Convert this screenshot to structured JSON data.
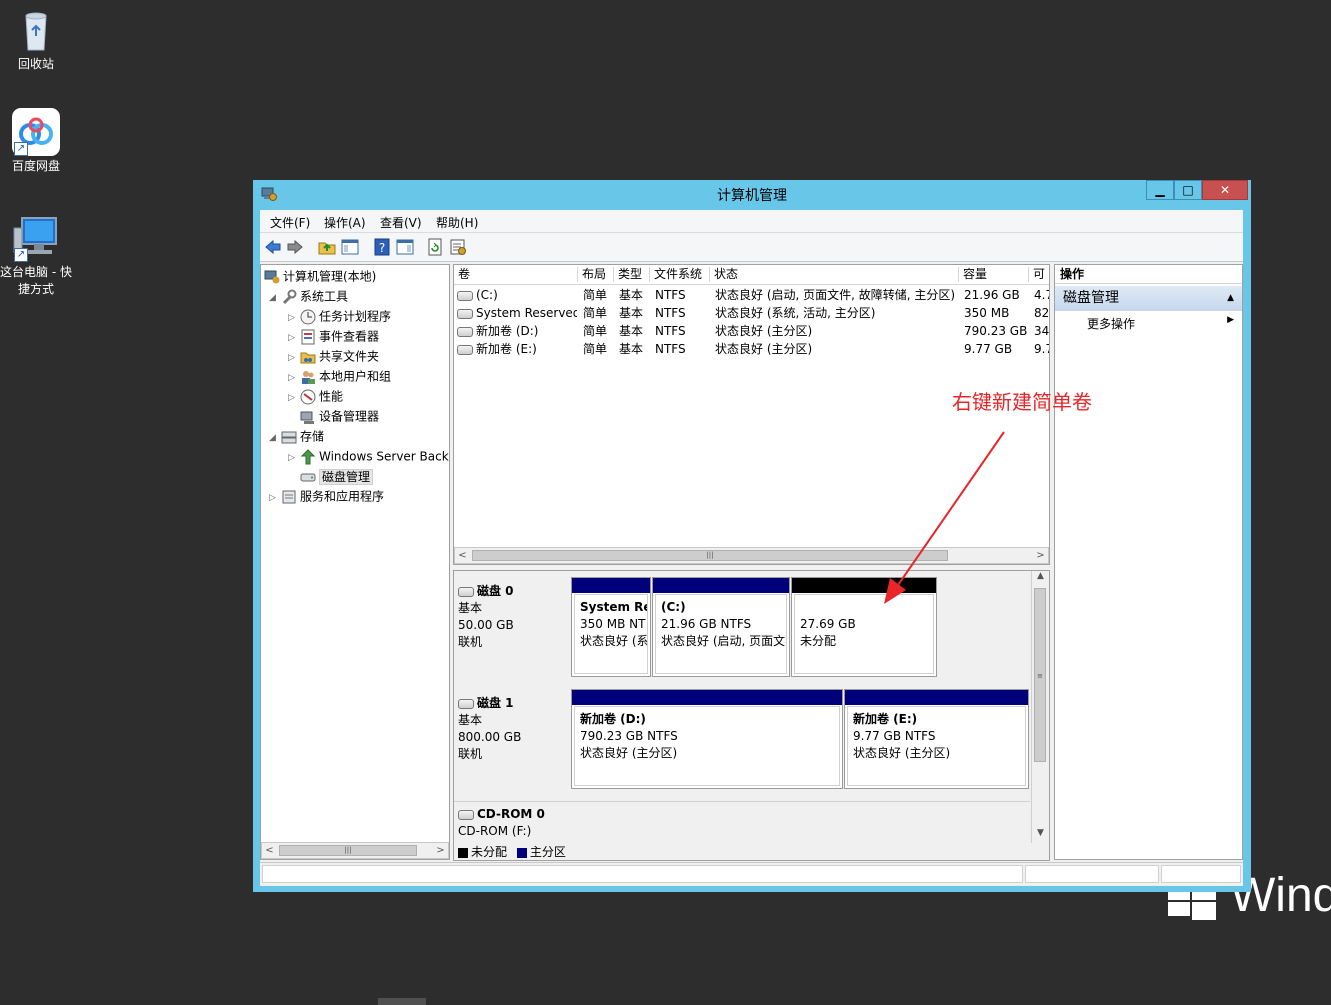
{
  "desktop": {
    "icons": [
      {
        "label": "回收站",
        "icon": "recycle-bin-icon"
      },
      {
        "label": "百度网盘",
        "icon": "baidu-netdisk-icon"
      },
      {
        "label": "这台电脑 - 快捷方式",
        "icon": "this-pc-icon"
      }
    ],
    "logo_text": "Windo"
  },
  "window": {
    "title": "计算机管理",
    "buttons": {
      "minimize": "▁",
      "maximize": "□",
      "close": "✕"
    }
  },
  "menu": [
    "文件(F)",
    "操作(A)",
    "查看(V)",
    "帮助(H)"
  ],
  "tree": {
    "root": "计算机管理(本地)",
    "system_tools": "系统工具",
    "task_scheduler": "任务计划程序",
    "event_viewer": "事件查看器",
    "shared_folders": "共享文件夹",
    "local_users": "本地用户和组",
    "performance": "性能",
    "device_manager": "设备管理器",
    "storage": "存储",
    "windows_backup": "Windows Server Back",
    "disk_management": "磁盘管理",
    "services_apps": "服务和应用程序"
  },
  "volume_list": {
    "columns": [
      "卷",
      "布局",
      "类型",
      "文件系统",
      "状态",
      "容量",
      "可"
    ],
    "rows": [
      {
        "volume": "(C:)",
        "layout": "简单",
        "type": "基本",
        "fs": "NTFS",
        "status": "状态良好 (启动, 页面文件, 故障转储, 主分区)",
        "capacity": "21.96 GB",
        "free": "4.7"
      },
      {
        "volume": "System Reserved",
        "layout": "简单",
        "type": "基本",
        "fs": "NTFS",
        "status": "状态良好 (系统, 活动, 主分区)",
        "capacity": "350 MB",
        "free": "82"
      },
      {
        "volume": "新加卷 (D:)",
        "layout": "简单",
        "type": "基本",
        "fs": "NTFS",
        "status": "状态良好 (主分区)",
        "capacity": "790.23 GB",
        "free": "34"
      },
      {
        "volume": "新加卷 (E:)",
        "layout": "简单",
        "type": "基本",
        "fs": "NTFS",
        "status": "状态良好 (主分区)",
        "capacity": "9.77 GB",
        "free": "9.7"
      }
    ]
  },
  "disks": [
    {
      "name": "磁盘 0",
      "kind": "基本",
      "size": "50.00 GB",
      "state": "联机",
      "partitions": [
        {
          "title": "System Re:",
          "line1": "350 MB NT",
          "line2": "状态良好 (系",
          "bar": "#00007b"
        },
        {
          "title": "(C:)",
          "line1": "21.96 GB NTFS",
          "line2": "状态良好 (启动, 页面文",
          "bar": "#00007b"
        },
        {
          "title": "",
          "line1": "27.69 GB",
          "line2": "未分配",
          "bar": "#000000"
        }
      ]
    },
    {
      "name": "磁盘 1",
      "kind": "基本",
      "size": "800.00 GB",
      "state": "联机",
      "partitions": [
        {
          "title": "新加卷  (D:)",
          "line1": "790.23 GB NTFS",
          "line2": "状态良好 (主分区)",
          "bar": "#00007b"
        },
        {
          "title": "新加卷  (E:)",
          "line1": "9.77 GB NTFS",
          "line2": "状态良好 (主分区)",
          "bar": "#00007b"
        }
      ]
    },
    {
      "name": "CD-ROM 0",
      "kind": "CD-ROM (F:)"
    }
  ],
  "legend": [
    {
      "label": "未分配",
      "color": "#000000"
    },
    {
      "label": "主分区",
      "color": "#00007b"
    }
  ],
  "actions": {
    "header": "操作",
    "section": "磁盘管理",
    "more": "更多操作"
  },
  "annotation": {
    "text": "右键新建简单卷",
    "color": "#e8262a"
  }
}
